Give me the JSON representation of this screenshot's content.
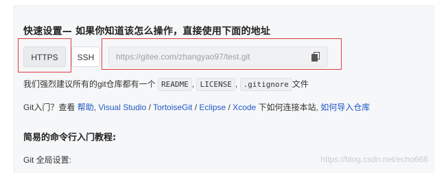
{
  "heading": "快速设置— 如果你知道该怎么操作，直接使用下面的地址",
  "protocols": {
    "https_label": "HTTPS",
    "ssh_label": "SSH"
  },
  "clone_url": {
    "value": "https://gitee.com/zhangyao97/test.git",
    "copy_icon": "copy-icon"
  },
  "recommend_line": {
    "prefix": "我们强烈建议所有的git仓库都有一个",
    "readme": "README",
    "sep1": ",",
    "license": "LICENSE",
    "sep2": ",",
    "gitignore": ".gitignore",
    "suffix": "文件"
  },
  "help_line": {
    "prefix": "Git入门？查看",
    "help_link": "帮助",
    "sep1": ",",
    "vs_link": "Visual Studio",
    "slash1": "/",
    "tortoise_link": "TortoiseGit",
    "slash2": "/",
    "eclipse_link": "Eclipse",
    "slash3": "/",
    "xcode_link": "Xcode",
    "connect_text": "下如何连接本站,",
    "import_link": "如何导入仓库"
  },
  "tutorial_heading": "简易的命令行入门教程:",
  "git_global": "Git 全局设置:",
  "watermark": "https://blog.csdn.net/echo666",
  "colors": {
    "link": "#1f57c7",
    "highlight_box": "#e0393e",
    "panel_bg": "#f6f7f8"
  }
}
